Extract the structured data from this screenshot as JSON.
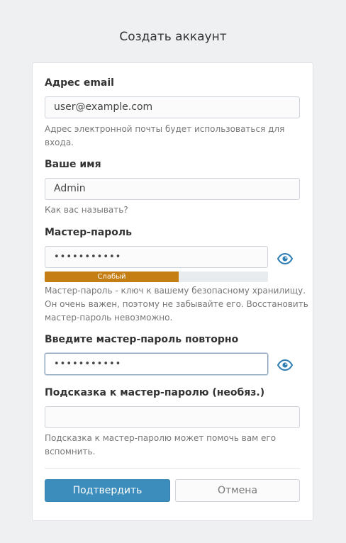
{
  "page": {
    "title": "Создать аккаунт"
  },
  "form": {
    "email": {
      "label": "Адрес email",
      "value": "user@example.com",
      "help_line1": "Адрес электронной почты будет использоваться для",
      "help_line2": "входа."
    },
    "name": {
      "label": "Ваше имя",
      "value": "Admin",
      "help": "Как вас называть?"
    },
    "master_password": {
      "label": "Мастер-пароль",
      "masked_value": "•••••••••••",
      "strength_label": "Слабый",
      "strength_fraction": 0.6,
      "strength_color": "#c47e14",
      "help_line1": "Мастер-пароль - ключ к вашему безопасному хранилищу.",
      "help_line2": "Он очень важен, поэтому не забывайте его. Восстановить",
      "help_line3": "мастер-пароль невозможно."
    },
    "confirm_password": {
      "label": "Введите мастер-пароль повторно",
      "masked_value": "•••••••••••"
    },
    "hint": {
      "label": "Подсказка к мастер-паролю (необяз.)",
      "value": "",
      "help_line1": "Подсказка к мастер-паролю может помочь вам его",
      "help_line2": "вспомнить."
    }
  },
  "actions": {
    "submit_label": "Подтвердить",
    "cancel_label": "Отмена"
  },
  "colors": {
    "primary": "#3c8dbc",
    "eye_icon": "#2f7fb5",
    "background": "#eef0f2"
  },
  "icons": {
    "show_password": "eye-icon",
    "show_confirm_password": "eye-icon"
  }
}
